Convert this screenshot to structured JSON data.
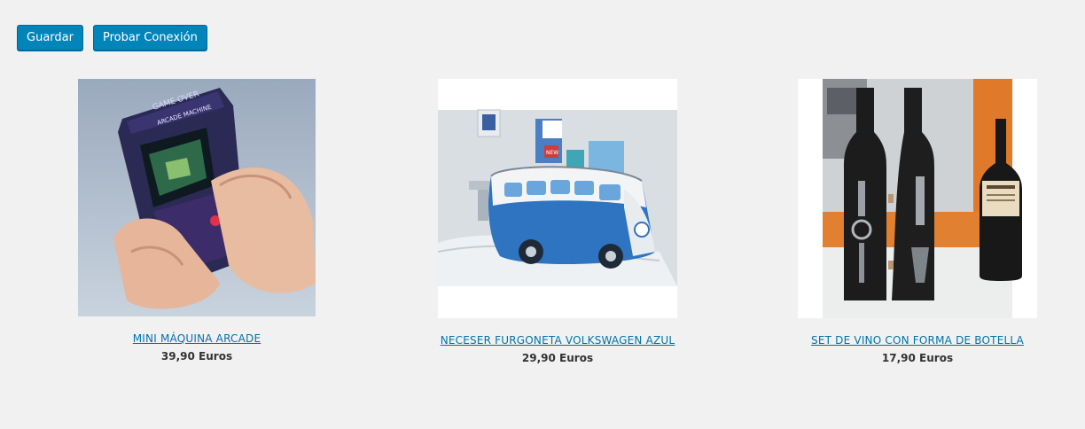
{
  "toolbar": {
    "save_label": "Guardar",
    "test_connection_label": "Probar Conexión"
  },
  "products": [
    {
      "name": "MINI MÁQUINA ARCADE",
      "price": "39,90 Euros",
      "screen_text_1": "GAME OVER",
      "screen_text_2": "ARCADE MACHINE"
    },
    {
      "name": "NECESER FURGONETA VOLKSWAGEN AZUL",
      "price": "29,90 Euros",
      "bottle_label": "NEW"
    },
    {
      "name": "SET DE VINO CON FORMA DE BOTELLA",
      "price": "17,90 Euros"
    }
  ],
  "colors": {
    "button_bg": "#0085ba",
    "link": "#0073aa",
    "page_bg": "#f1f1f1"
  }
}
